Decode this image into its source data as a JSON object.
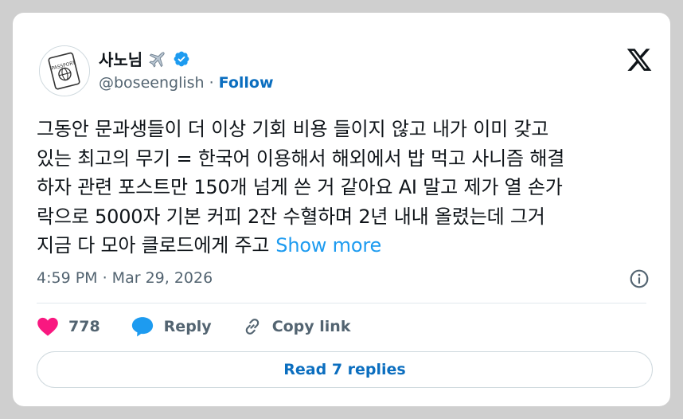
{
  "author": {
    "display_name": "사노님",
    "handle": "@boseenglish",
    "follow_label": "Follow",
    "separator": "·",
    "avatar_text": "PASSPORT"
  },
  "tweet": {
    "lines": [
      "그동안 문과생들이 더 이상 기회 비용 들이지 않고 내가 이미 갖고",
      "있는 최고의 무기 = 한국어 이용해서 해외에서 밥 먹고 사니즘 해결",
      "하자 관련 포스트만 150개 넘게 쓴 거 같아요 AI 말고 제가 열 손가",
      "락으로 5000자 기본 커피 2잔 수혈하며 2년 내내 올렸는데 그거",
      "지금 다 모아 클로드에게 주고"
    ],
    "show_more_label": "Show more",
    "timestamp": "4:59 PM · Mar 29, 2026"
  },
  "actions": {
    "like_count": "778",
    "reply_label": "Reply",
    "copy_link_label": "Copy link"
  },
  "replies_button_label": "Read 7 replies",
  "colors": {
    "link_blue": "#0b6ebf",
    "show_more_blue": "#1d9bf0",
    "like_pink": "#f91880",
    "verified_blue": "#1d9bf0",
    "text_dark": "#0f1419",
    "text_gray": "#536471"
  }
}
